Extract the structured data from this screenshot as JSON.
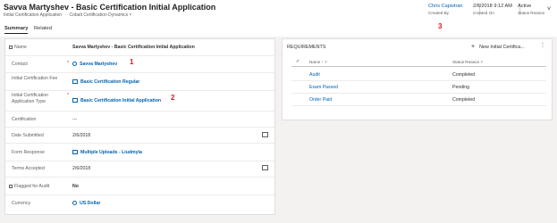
{
  "header": {
    "title": "Savva Martyshev - Basic Certification Initial Application",
    "subtitle_entity": "Initial Certification Application",
    "subtitle_separator": "·",
    "subtitle_form": "Cobalt Certification Dynamics",
    "owner_value": "Chris Capistran",
    "owner_label": "Created By",
    "created_value": "2/6/2018 9:12 AM",
    "created_label": "Created On",
    "status_value": "Active",
    "status_label": "Status Reason"
  },
  "tabs": [
    {
      "label": "Summary"
    },
    {
      "label": "Related"
    }
  ],
  "annotations": [
    "1",
    "2",
    "3"
  ],
  "form": {
    "name_label": "Name",
    "name_value": "Savva Martyshev - Basic Certification Initial Application",
    "contact_label": "Contact",
    "contact_value": "Savva Martyshev",
    "fee_label": "Initial Certification Fee",
    "fee_value": "Basic Certification Regular",
    "apptype_label": "Initial Certification Application Type",
    "apptype_value": "Basic Certification Initial Application",
    "certification_label": "Certification",
    "certification_value": "---",
    "date_submitted_label": "Date Submitted",
    "date_submitted_value": "2/6/2018",
    "form_response_label": "Form Response",
    "form_response_value": "Multiple Uploads - Liudmyla",
    "terms_label": "Terms Accepted",
    "terms_value": "2/6/2018",
    "flagged_label": "Flagged for Audit",
    "flagged_value": "No",
    "currency_label": "Currency",
    "currency_value": "US Dollar",
    "required_marker": "*"
  },
  "requirements": {
    "title": "REQUIREMENTS",
    "new_button_label": "New Initial Certifica...",
    "more_label": "⋮",
    "col_name": "Name ↑ ˅",
    "col_status": "Status Reason ˅",
    "rows": [
      {
        "name": "Audit",
        "status": "Completed"
      },
      {
        "name": "Exam Passed",
        "status": "Pending"
      },
      {
        "name": "Order Paid",
        "status": "Completed"
      }
    ]
  }
}
